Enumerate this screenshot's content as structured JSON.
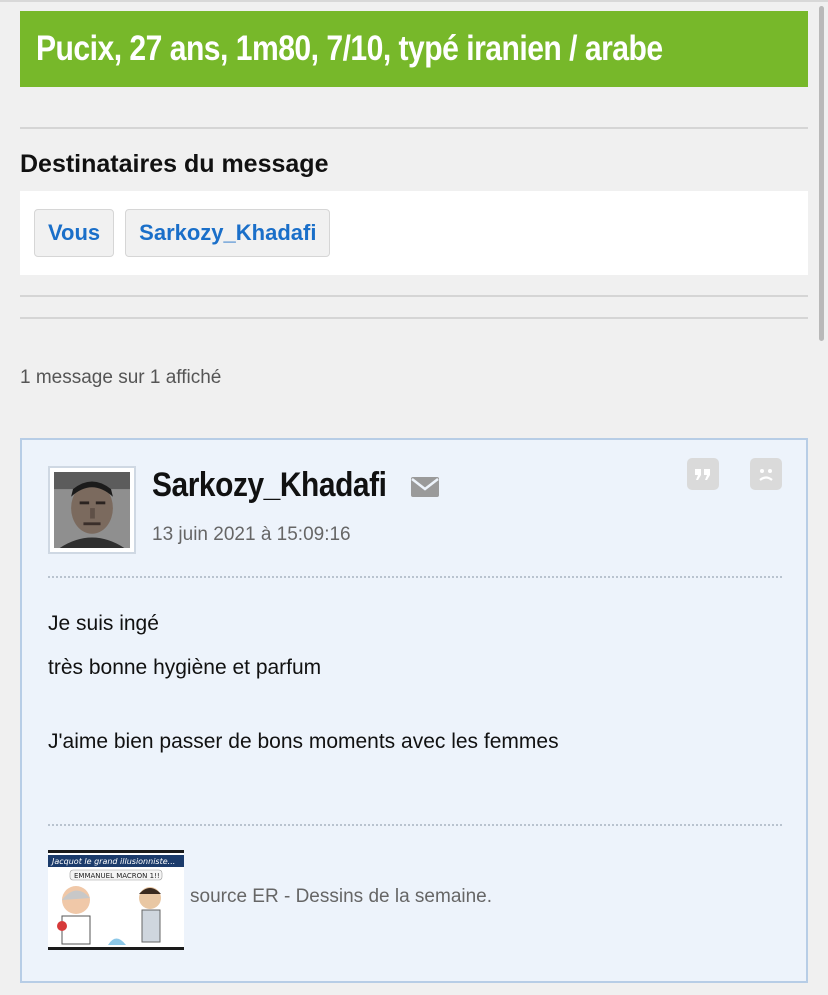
{
  "topic": {
    "title": "Pucix, 27 ans, 1m80, 7/10, typé iranien / arabe",
    "accent_color": "#77b82a"
  },
  "recipients": {
    "heading": "Destinataires du message",
    "items": [
      "Vous",
      "Sarkozy_Khadafi"
    ]
  },
  "message_count": "1 message sur 1 affiché",
  "message": {
    "author": "Sarkozy_Khadafi",
    "date": "13 juin 2021 à 15:09:16",
    "body": [
      "Je suis ingé",
      "très bonne hygiène et parfum",
      "J'aime bien passer de bons moments avec les femmes"
    ],
    "signature": {
      "image_caption": "Jacquot le grand illusionniste...",
      "image_bubble": "EMMANUEL MACRON 1!!",
      "text": "source ER - Dessins de la semaine."
    },
    "icons": [
      "mail-icon",
      "quote-icon",
      "report-icon"
    ]
  }
}
